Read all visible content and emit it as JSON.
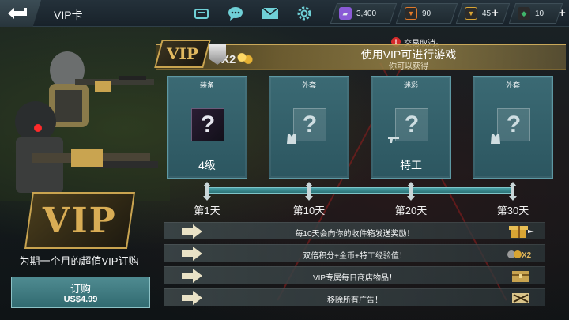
{
  "header": {
    "title": "VIP卡",
    "icons": [
      "gamepad-icon",
      "chat-icon",
      "mail-icon",
      "gear-icon"
    ]
  },
  "currencies": [
    {
      "name": "vip-points",
      "value": "3,400",
      "color": "#8a5bd6"
    },
    {
      "name": "rank-points",
      "value": "90",
      "color": "#e07a2a"
    },
    {
      "name": "gold",
      "value": "45",
      "color": "#d9a534",
      "plus": "+"
    },
    {
      "name": "diamonds",
      "value": "10",
      "color": "#3fb56a",
      "plus": "+"
    }
  ],
  "notice": {
    "mark": "!",
    "text": "交易取消。"
  },
  "banner": {
    "title": "使用VIP可进行游戏",
    "subtitle": "你可以获得",
    "vip_mark": "VIP",
    "x2_mark": "X2"
  },
  "rewards": [
    {
      "label": "装备",
      "name": "4级",
      "box": "?"
    },
    {
      "label": "外套",
      "name": "",
      "box": "?"
    },
    {
      "label": "迷彩",
      "name": "特工",
      "box": "?"
    },
    {
      "label": "外套",
      "name": "",
      "box": "?"
    }
  ],
  "days": [
    "第1天",
    "第10天",
    "第20天",
    "第30天"
  ],
  "benefits": [
    "每10天会向你的收件箱发送奖励！",
    "双倍积分+金币+特工经验值！",
    "VIP专属每日商店物品！",
    "移除所有广告！"
  ],
  "left_panel": {
    "logo": "VIP",
    "promo": "为期一个月的超值VIP订购",
    "buy_label": "订购",
    "price": "US$4.99"
  }
}
